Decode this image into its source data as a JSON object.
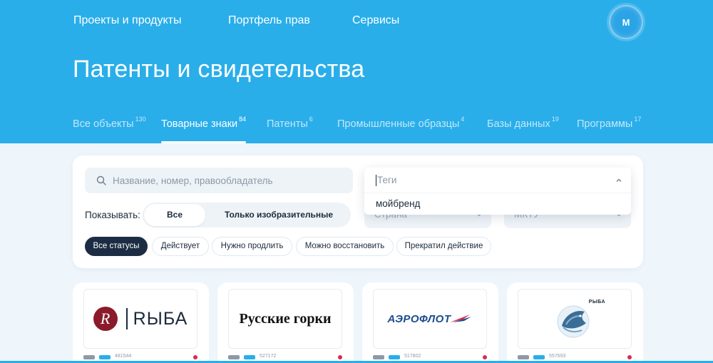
{
  "nav": {
    "items": [
      "Проекты и продукты",
      "Портфель прав",
      "Сервисы"
    ],
    "avatar_initial": "M"
  },
  "page": {
    "title": "Патенты и свидетельства"
  },
  "tabs": [
    {
      "label": "Все объекты",
      "count": "130",
      "active": false
    },
    {
      "label": "Товарные знаки",
      "count": "84",
      "active": true
    },
    {
      "label": "Патенты",
      "count": "6",
      "active": false
    },
    {
      "label": "Промышленные образцы",
      "count": "4",
      "active": false
    },
    {
      "label": "Базы данных",
      "count": "19",
      "active": false
    },
    {
      "label": "Программы",
      "count": "17",
      "active": false
    }
  ],
  "filters": {
    "search_placeholder": "Название, номер, правообладатель",
    "show_label": "Показывать:",
    "show_options": [
      "Все",
      "Только изобразительные"
    ],
    "show_selected": "Все",
    "country_placeholder": "Страна",
    "mktu_placeholder": "МКТУ",
    "tags_placeholder": "Теги",
    "tags_options": [
      "мойбренд"
    ],
    "statuses": [
      "Все статусы",
      "Действует",
      "Нужно продлить",
      "Можно восстановить",
      "Прекратил действие"
    ],
    "status_selected": "Все статусы"
  },
  "cards": [
    {
      "logo_letter": "R",
      "logo_text": "RЫБА",
      "number": "481544"
    },
    {
      "logo_text": "Русские горки",
      "number": "527172"
    },
    {
      "logo_text": "АЭРОФЛОТ",
      "number": "517802"
    },
    {
      "logo_text": "РЫБА",
      "number": "557693"
    }
  ],
  "colors": {
    "hero": "#29aeea",
    "dark_chip": "#1c2d43",
    "status_dot": "#e0294a"
  }
}
